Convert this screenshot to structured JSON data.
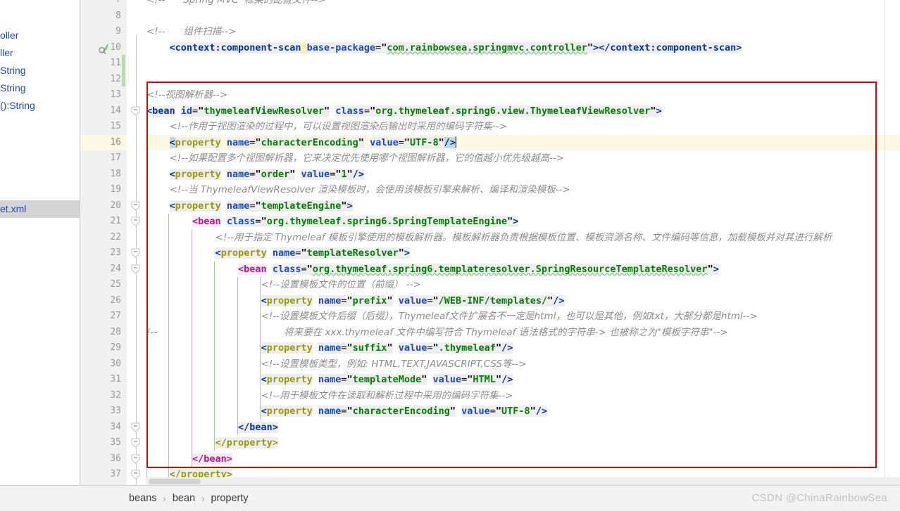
{
  "app": {
    "kind": "ide-xml-editor",
    "watermark": "CSDN @ChinaRainbowSea"
  },
  "structure_panel": {
    "items": [
      {
        "label": "oller",
        "kind": "class",
        "selected": false
      },
      {
        "label": "ller",
        "kind": "method",
        "selected": false
      },
      {
        "label": "String",
        "kind": "method",
        "selected": false
      },
      {
        "label": "String",
        "kind": "method",
        "selected": false
      },
      {
        "label": "():String",
        "kind": "method",
        "selected": false
      },
      {
        "label": "et.xml",
        "kind": "file",
        "selected": true
      }
    ]
  },
  "gutter": {
    "first_line": 7,
    "last_line": 37,
    "current_line": 16,
    "bean_icon_line": 10,
    "fold_lines": [
      14,
      20,
      21,
      23,
      24,
      34,
      35,
      36,
      37
    ],
    "icon_name": "spring-bean-icon"
  },
  "editor": {
    "lines": [
      {
        "n": 7,
        "html": "<span class='cmtz'>&lt;!--      Spring MVC  框架的配置文件--&gt;</span>",
        "indent": 0
      },
      {
        "n": 8,
        "html": "",
        "indent": 0
      },
      {
        "n": 9,
        "html": "<span class='cmtz'>&lt;!--      组件扫描--&gt;</span>",
        "indent": 0
      },
      {
        "n": 10,
        "html": "    <span class='hl'><span class='tag'>&lt;context:component-scan</span> <span class='attr'>base-package</span><span class='eq'>=</span><span class='strq'>\"</span><span class='str wavy'>com.rainbowsea.springmvc.controller</span><span class='strq'>\"</span><span class='tag'>&gt;&lt;/context:component-scan&gt;</span></span>",
        "indent": 0
      },
      {
        "n": 11,
        "html": "",
        "indent": 0
      },
      {
        "n": 12,
        "html": "",
        "indent": 0
      },
      {
        "n": 13,
        "html": "<span class='cmtz'>&lt;!--视图解析器--&gt;</span>",
        "indent": 0
      },
      {
        "n": 14,
        "html": "<span class='tag'>&lt;bean</span> <span class='attr'>id</span><span class='eq'>=</span><span class='strq'>\"</span><span class='str'>thymeleafViewResolver</span><span class='strq'>\"</span> <span class='attr'>class</span><span class='eq'>=</span><span class='strq'>\"</span><span class='str'>org.thymeleaf.spring6.view.ThymeleafViewResolver</span><span class='strq'>\"</span><span class='tag'>&gt;</span>",
        "indent": 0
      },
      {
        "n": 15,
        "html": "    <span class='cmtz'>&lt;!--作用于视图渲染的过程中，可以设置视图渲染后输出时采用的编码字符集--&gt;</span>",
        "indent": 1
      },
      {
        "n": 16,
        "html": "    <span class='brmatch'>&lt;</span><span class='proptag'>property</span> <span class='attr'>name</span><span class='eq'>=</span><span class='strq'>\"</span><span class='str'>characterEncoding</span><span class='strq'>\"</span> <span class='attr'>value</span><span class='eq'>=</span><span class='strq'>\"</span><span class='str'>UTF-8</span><span class='strq'>\"</span><span class='brmatch'>/&gt;</span><span class='caret'></span>",
        "indent": 1,
        "current": true
      },
      {
        "n": 17,
        "html": "    <span class='cmtz'>&lt;!--如果配置多个视图解析器，它来决定优先使用哪个视图解析器，它的值越小优先级越高--&gt;</span>",
        "indent": 1
      },
      {
        "n": 18,
        "html": "    <span class='tag'>&lt;</span><span class='proptag'>property</span> <span class='attr'>name</span><span class='eq'>=</span><span class='strq'>\"</span><span class='str'>order</span><span class='strq'>\"</span> <span class='attr'>value</span><span class='eq'>=</span><span class='strq'>\"</span><span class='str'>1</span><span class='strq'>\"</span><span class='tag'>/&gt;</span>",
        "indent": 1
      },
      {
        "n": 19,
        "html": "    <span class='cmtz'>&lt;!--当 ThymeleafViewResolver 渲染模板时，会使用该模板引擎来解析、编译和渲染模板--&gt;</span>",
        "indent": 1
      },
      {
        "n": 20,
        "html": "    <span class='tag'>&lt;</span><span class='proptag'>property</span> <span class='attr'>name</span><span class='eq'>=</span><span class='strq'>\"</span><span class='str'>templateEngine</span><span class='strq'>\"</span><span class='tag'>&gt;</span>",
        "indent": 1
      },
      {
        "n": 21,
        "html": "        <span class='beantag'>&lt;bean</span> <span class='attr'>class</span><span class='eq'>=</span><span class='strq'>\"</span><span class='str'>org.thymeleaf.spring6.SpringTemplateEngine</span><span class='strq'>\"</span><span class='tag'>&gt;</span>",
        "indent": 2
      },
      {
        "n": 22,
        "html": "            <span class='cmtz'>&lt;!--用于指定 Thymeleaf 模板引擎使用的模板解析器。模板解析器负责根据模板位置、模板资源名称、文件编码等信息，加载模板并对其进行解析</span>",
        "indent": 3
      },
      {
        "n": 23,
        "html": "            <span class='tag'>&lt;</span><span class='proptag'>property</span> <span class='attr'>name</span><span class='eq'>=</span><span class='strq'>\"</span><span class='str'>templateResolver</span><span class='strq'>\"</span><span class='tag'>&gt;</span>",
        "indent": 3
      },
      {
        "n": 24,
        "html": "                <span class='beantag'>&lt;bean</span> <span class='attr'>class</span><span class='eq'>=</span><span class='strq'>\"</span><span class='str wavy'>org.thymeleaf.spring6.templateresolver.SpringResourceTemplateResolver</span><span class='strq'>\"</span><span class='tag'>&gt;</span>",
        "indent": 4
      },
      {
        "n": 25,
        "html": "                    <span class='cmtz'>&lt;!--设置模板文件的位置（前缀） --&gt;</span>",
        "indent": 5
      },
      {
        "n": 26,
        "html": "                    <span class='tag'>&lt;</span><span class='proptag'>property</span> <span class='attr'>name</span><span class='eq'>=</span><span class='strq'>\"</span><span class='str'>prefix</span><span class='strq'>\"</span> <span class='attr'>value</span><span class='eq'>=</span><span class='strq'>\"</span><span class='str'>/WEB-INF/templates/</span><span class='strq'>\"</span><span class='tag'>/&gt;</span>",
        "indent": 5
      },
      {
        "n": 27,
        "html": "                    <span class='cmtz'>&lt;!--设置模板文件后缀（后缀），Thymeleaf文件扩展名不一定是html，也可以是其他，例如txt，大部分都是html--&gt;</span>",
        "indent": 5
      },
      {
        "n": 28,
        "html": "                        <span class='cmtz'>将来要在 xxx.thymeleaf 文件中编写符合 Thymeleaf 语法格式的字符串-&gt; 也被称之为\"模板字符串\"--&gt;</span>",
        "indent": 6,
        "wrap_marker": "&lt;!--"
      },
      {
        "n": 29,
        "html": "                    <span class='tag'>&lt;</span><span class='proptag'>property</span> <span class='attr'>name</span><span class='eq'>=</span><span class='strq'>\"</span><span class='str'>suffix</span><span class='strq'>\"</span> <span class='attr'>value</span><span class='eq'>=</span><span class='strq'>\"</span><span class='str'>.thymeleaf</span><span class='strq'>\"</span><span class='tag'>/&gt;</span>",
        "indent": 5
      },
      {
        "n": 30,
        "html": "                    <span class='cmtz'>&lt;!--设置模板类型，例如: HTML,TEXT,JAVASCRIPT,CSS等--&gt;</span>",
        "indent": 5
      },
      {
        "n": 31,
        "html": "                    <span class='tag'>&lt;</span><span class='proptag'>property</span> <span class='attr'>name</span><span class='eq'>=</span><span class='strq'>\"</span><span class='str'>templateMode</span><span class='strq'>\"</span> <span class='attr'>value</span><span class='eq'>=</span><span class='strq'>\"</span><span class='str'>HTML</span><span class='strq'>\"</span><span class='tag'>/&gt;</span>",
        "indent": 5
      },
      {
        "n": 32,
        "html": "                    <span class='cmtz'>&lt;!--用于模板文件在读取和解析过程中采用的编码字符集--&gt;</span>",
        "indent": 5
      },
      {
        "n": 33,
        "html": "                    <span class='tag'>&lt;</span><span class='proptag'>property</span> <span class='attr'>name</span><span class='eq'>=</span><span class='strq'>\"</span><span class='str'>characterEncoding</span><span class='strq'>\"</span> <span class='attr'>value</span><span class='eq'>=</span><span class='strq'>\"</span><span class='str'>UTF-8</span><span class='strq'>\"</span><span class='tag'>/&gt;</span>",
        "indent": 5
      },
      {
        "n": 34,
        "html": "                <span class='tag'>&lt;/bean&gt;</span>",
        "indent": 4
      },
      {
        "n": 35,
        "html": "            <span class='proptag'>&lt;/property&gt;</span>",
        "indent": 3
      },
      {
        "n": 36,
        "html": "        <span class='beantag'>&lt;/bean&gt;</span>",
        "indent": 2
      },
      {
        "n": 37,
        "html": "    <span class='proptag'>&lt;/property&gt;</span>",
        "indent": 1
      }
    ]
  },
  "breadcrumb": {
    "items": [
      "beans",
      "bean",
      "property"
    ],
    "separator": "›"
  },
  "annotation": {
    "shape": "rectangle",
    "color": "#e60000",
    "covers_lines": [
      13,
      36
    ]
  },
  "colors": {
    "gutter_bg": "#f0f0f0",
    "current_line": "#fdf8e2",
    "search_highlight": "#fff2b0",
    "bracket_match": "#b7d7f7",
    "annotation_red": "#e60000",
    "tag_blue": "#0033b3",
    "string_green": "#008000",
    "bean_magenta": "#c4128c",
    "property_olive": "#9a9a00",
    "comment_gray": "#8c8c8c",
    "breadcrumb_bg": "#f2f2f2"
  }
}
